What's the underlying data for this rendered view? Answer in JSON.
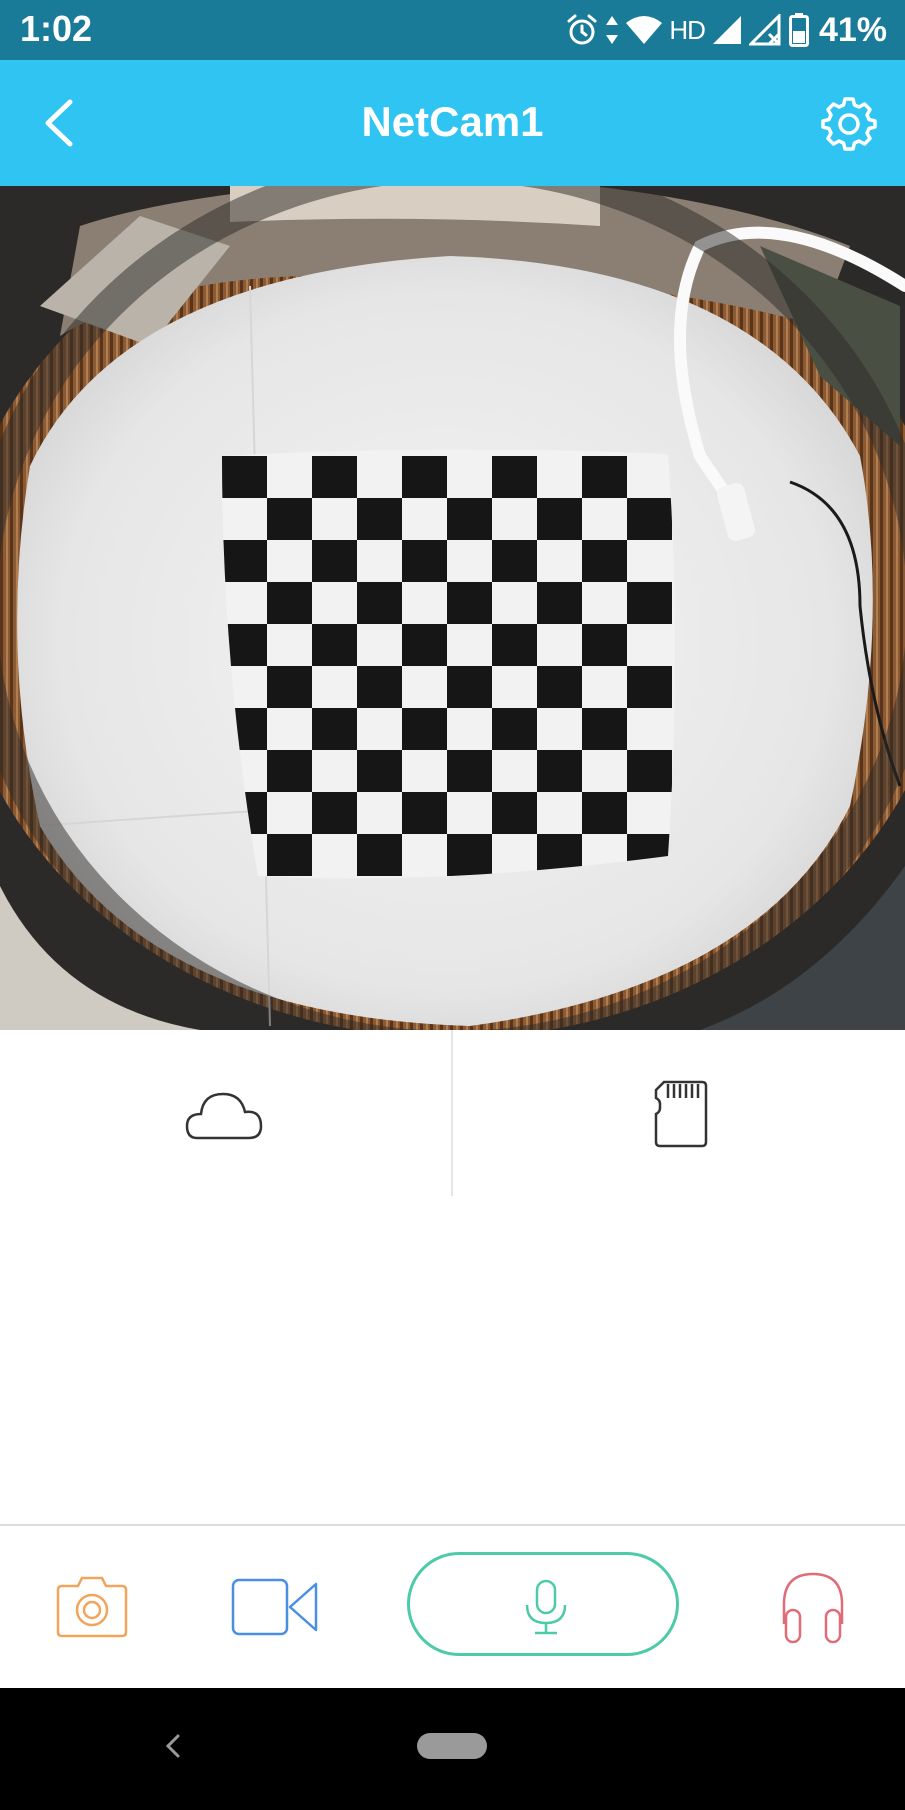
{
  "status_bar": {
    "time": "1:02",
    "network_label": "HD",
    "battery_percent": "41%",
    "icons": [
      "alarm-icon",
      "data-arrows-icon",
      "wifi-icon",
      "signal-icon",
      "signal-no-service-icon",
      "battery-icon"
    ]
  },
  "header": {
    "title": "NetCam1",
    "back_icon": "chevron-left-icon",
    "settings_icon": "gear-icon",
    "background_color": "#2fc4f2"
  },
  "camera_view": {
    "content": "fisheye camera live feed",
    "checkerboard_columns": 10,
    "checkerboard_rows": 10
  },
  "storage": {
    "left_icon": "cloud-icon",
    "right_icon": "sd-card-icon"
  },
  "toolbar": {
    "snapshot_icon": "camera-icon",
    "record_icon": "video-camera-icon",
    "talk_icon": "microphone-icon",
    "listen_icon": "headphones-icon",
    "colors": {
      "snapshot": "#f2a35c",
      "record": "#4a90e2",
      "talk": "#4dcaa8",
      "listen": "#e06c78"
    }
  },
  "nav_bar": {
    "back_icon": "nav-back-icon",
    "home_icon": "home-pill-icon"
  }
}
